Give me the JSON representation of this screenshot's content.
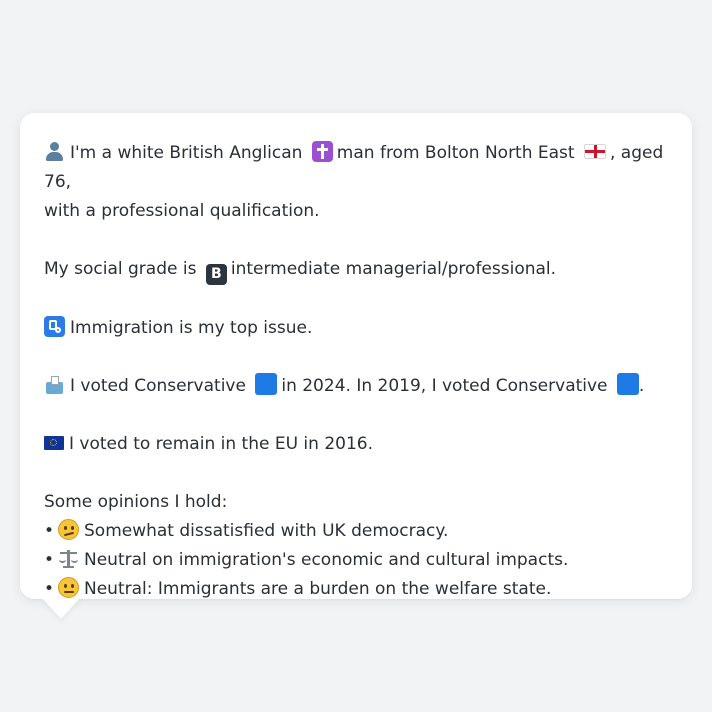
{
  "profile": {
    "line1_a": "I'm a white British Anglican",
    "line1_b": "man from Bolton North East",
    "line1_c": ", aged 76,",
    "line1_d": "with a professional qualification.",
    "grade_a": "My social grade is",
    "grade_b": "intermediate managerial/professional.",
    "issue": "Immigration is my top issue.",
    "vote_a": "I voted Conservative",
    "vote_b": "in 2024. In 2019, I voted Conservative",
    "vote_c": ".",
    "eu": "I voted to remain in the EU in 2016."
  },
  "opinions": {
    "heading": "Some opinions I hold:",
    "bullet": "•",
    "items": [
      {
        "icon": "confused-face-icon",
        "text": "Somewhat dissatisfied with UK democracy."
      },
      {
        "icon": "balance-scale-icon",
        "text": "Neutral on immigration's economic and cultural impacts."
      },
      {
        "icon": "neutral-face-icon",
        "text": "Neutral: Immigrants are a burden on the welfare state."
      }
    ]
  },
  "icons": {
    "person": "bust-in-silhouette-icon",
    "religion": "latin-cross-icon",
    "region_flag": "england-flag-icon",
    "grade_badge": "B",
    "issue": "passport-control-icon",
    "vote": "ballot-box-icon",
    "party": "blue-square-icon",
    "eu": "eu-flag-icon"
  },
  "colors": {
    "background": "#f2f3f5",
    "card": "#ffffff",
    "text": "#2b2f36",
    "conservative_blue": "#1e7be6"
  }
}
